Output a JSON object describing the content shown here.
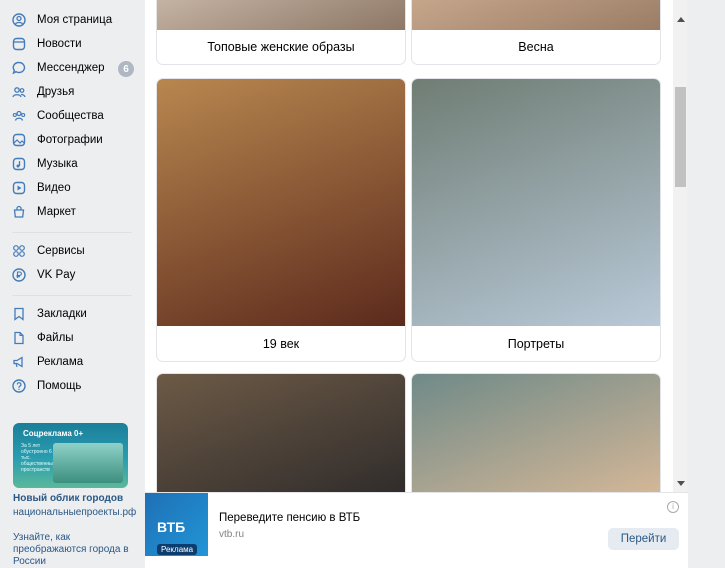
{
  "sidebar": {
    "items": [
      {
        "label": "Моя страница",
        "icon": "user-circle-icon"
      },
      {
        "label": "Новости",
        "icon": "news-icon"
      },
      {
        "label": "Мессенджер",
        "icon": "chat-icon",
        "badge": "6"
      },
      {
        "label": "Друзья",
        "icon": "friends-icon"
      },
      {
        "label": "Сообщества",
        "icon": "communities-icon"
      },
      {
        "label": "Фотографии",
        "icon": "photos-icon"
      },
      {
        "label": "Музыка",
        "icon": "music-icon"
      },
      {
        "label": "Видео",
        "icon": "video-icon"
      },
      {
        "label": "Маркет",
        "icon": "market-icon"
      },
      {
        "label": "Сервисы",
        "icon": "services-icon"
      },
      {
        "label": "VK Pay",
        "icon": "vkpay-icon"
      },
      {
        "label": "Закладки",
        "icon": "bookmark-icon"
      },
      {
        "label": "Файлы",
        "icon": "files-icon"
      },
      {
        "label": "Реклама",
        "icon": "ads-icon"
      },
      {
        "label": "Помощь",
        "icon": "help-icon"
      }
    ],
    "promo": {
      "image_title": "Соцреклама 0+",
      "image_text": "За 5 лет обустроено 6 тыс. общественных пространств",
      "title": "Новый облик городов",
      "link": "национальныепроекты.рф",
      "description": "Узнайте, как преображаются города в России"
    }
  },
  "albums": [
    {
      "caption": "Топовые женские образы",
      "palette": [
        "#c9b8a8",
        "#8d7766"
      ]
    },
    {
      "caption": "Весна",
      "palette": [
        "#caa98e",
        "#9a7d66"
      ]
    },
    {
      "caption": "19 век",
      "palette": [
        "#b8874f",
        "#5c2a1c"
      ]
    },
    {
      "caption": "Портреты",
      "palette": [
        "#6f7d74",
        "#b9c9d8"
      ]
    },
    {
      "caption": "",
      "palette": [
        "#6d5a46",
        "#2d2a2a"
      ]
    },
    {
      "caption": "",
      "palette": [
        "#6f8a88",
        "#d9b998"
      ]
    }
  ],
  "ad": {
    "title": "Переведите пенсию в ВТБ",
    "url": "vtb.ru",
    "button": "Перейти",
    "logo": "ВТБ",
    "tag": "Реклама",
    "info_icon": "info-icon"
  },
  "colors": {
    "link": "#2a5885",
    "background": "#edeef0",
    "badge": "#aeb7c2"
  }
}
